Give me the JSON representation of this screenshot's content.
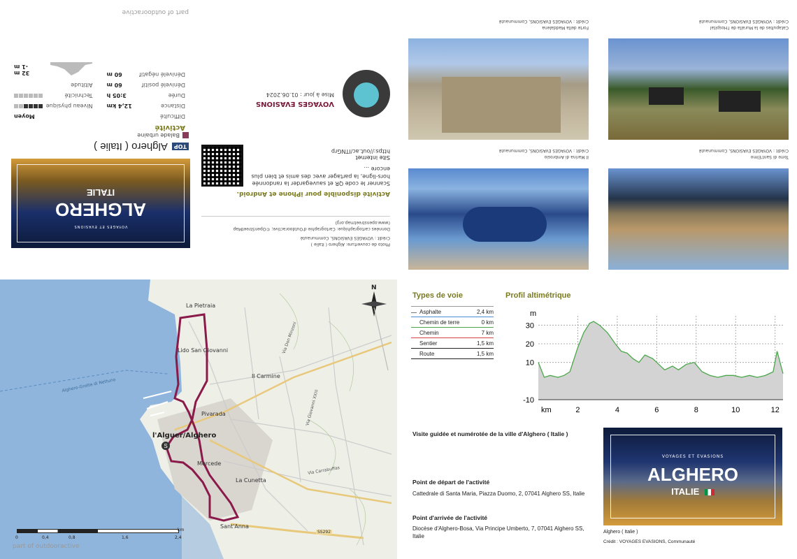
{
  "top_left": {
    "footer": "part of outdooractive",
    "category": "Balade urbaine",
    "top_badge": "TOP",
    "route_title": "Alghero ( Italie )",
    "cover_title": "ALGHERO",
    "cover_subtitle": "ITALIE",
    "cover_small": "VOYAGES ET EVASIONS",
    "activity_heading": "Activité",
    "stats": [
      {
        "label": "Difficulté",
        "value": "Moyen"
      },
      {
        "label": "Distance",
        "value": "12,4 km"
      },
      {
        "label": "Durée",
        "value": "3:05 h"
      },
      {
        "label": "Dénivelé positif",
        "value": "60 m"
      },
      {
        "label": "Dénivelé négatif",
        "value": "60 m"
      }
    ],
    "levels": [
      {
        "label": "Niveau physique",
        "filled": 4,
        "total": 6
      },
      {
        "label": "Technicité",
        "filled": 0,
        "total": 6
      }
    ],
    "altitude_label": "Altitude",
    "altitude_max": "32 m",
    "altitude_min": "-1 m",
    "publisher": "VOYAGES EVASIONS",
    "updated": "Mise à jour : 01.06.2024",
    "app_heading": "Activité disponible pour iPhone et Android.",
    "app_text": "Scanner le code QR et sauvegarder la randonnée hors-ligne, la partager avec des amis et bien plus encore ...",
    "site_label": "Site internet",
    "site_url": "https://out.ac/ITNGrp",
    "credit_cover": "Photo de couverture: Alghero ( Italie )",
    "credit_line": "Crédit : VOYAGES EVASIONS, Communauté",
    "map_data": "Données cartographique: Cartographie d'Outdooractive; ©OpenStreetMap",
    "osm_url": "(www.openstreetmap.org)"
  },
  "photos": [
    {
      "caption": "Catapultes de la Muralla de l'Hospital",
      "credit": "Crédit : VOYAGES EVASIONS, Communauté"
    },
    {
      "caption": "Forte della Maddalena",
      "credit": "Crédit : VOYAGES EVASIONS, Communauté"
    },
    {
      "caption": "Torre di Sant'Elmo",
      "credit": "Crédit : VOYAGES EVASIONS, Communauté"
    },
    {
      "caption": "Il Marina di Ambrosio",
      "credit": "Crédit : VOYAGES EVASIONS, Communauté"
    }
  ],
  "map": {
    "places": [
      "La Pietraia",
      "Lido San Giovanni",
      "Il Carmine",
      "Pivarada",
      "l'Alguer/Alghero",
      "Mercede",
      "La Cunetta",
      "Sant'Anna",
      "Alghero-Grotte di Nettuno",
      "SS292",
      "Via Don Minzoni",
      "Via Giovanni XXIII",
      "Via Carrabuffas"
    ],
    "scale_ticks": [
      "0",
      "0,4",
      "0,8",
      "1,6",
      "2,4"
    ],
    "scale_unit": "km",
    "footer": "part of outdooractive",
    "north": "N"
  },
  "voie": {
    "heading": "Types de voie",
    "rows": [
      {
        "label": "Asphalte",
        "value": "2,4 km",
        "color": "#777777"
      },
      {
        "label": "Chemin de terre",
        "value": "0 km",
        "color": "#4a90d9"
      },
      {
        "label": "Chemin",
        "value": "7 km",
        "color": "#4aa84a"
      },
      {
        "label": "Sentier",
        "value": "1,5 km",
        "color": "#d84040"
      },
      {
        "label": "Route",
        "value": "1,5 km",
        "color": "#222222"
      }
    ]
  },
  "profile": {
    "heading": "Profil altimétrique",
    "y_unit": "m",
    "x_unit": "km"
  },
  "chart_data": {
    "type": "area",
    "title": "Profil altimétrique",
    "xlabel": "km",
    "ylabel": "m",
    "x_ticks": [
      "2",
      "4",
      "6",
      "8",
      "10",
      "12"
    ],
    "y_ticks": [
      "30",
      "20",
      "10",
      "-10"
    ],
    "xlim": [
      0,
      12.4
    ],
    "ylim": [
      -10,
      35
    ],
    "x": [
      0,
      0.3,
      0.6,
      1,
      1.3,
      1.6,
      2,
      2.3,
      2.6,
      2.8,
      3.1,
      3.5,
      3.9,
      4.2,
      4.5,
      4.8,
      5.1,
      5.4,
      5.8,
      6.1,
      6.4,
      6.8,
      7.1,
      7.5,
      7.9,
      8.3,
      8.7,
      9.1,
      9.5,
      9.9,
      10.3,
      10.7,
      11.1,
      11.5,
      11.9,
      12.1,
      12.4
    ],
    "y": [
      10,
      2,
      3,
      2,
      3,
      5,
      18,
      26,
      31,
      32,
      30,
      26,
      20,
      16,
      15,
      12,
      10,
      14,
      12,
      9,
      6,
      8,
      6,
      9,
      10,
      5,
      3,
      2,
      3,
      3,
      2,
      3,
      2,
      3,
      5,
      16,
      4
    ],
    "grid": true
  },
  "bottom_right": {
    "tour_desc": "Visite guidée et numérotée de la ville d'Alghero ( Italie )",
    "start_heading": "Point de départ de l'activité",
    "start_text": "Cattedrale di Santa Maria, Piazza Duomo, 2, 07041 Alghero SS, Italie",
    "end_heading": "Point d'arrivée de l'activité",
    "end_text": "Diocèse d'Alghero-Bosa, Via Principe Umberto, 7, 07041 Alghero SS, Italie",
    "cover_title": "ALGHERO",
    "cover_subtitle": "ITALIE",
    "cover_small": "VOYAGES ET EVASIONS",
    "cover_caption": "Alghero ( Italie )",
    "cover_credit": "Crédit : VOYAGES EVASIONS, Communauté"
  }
}
